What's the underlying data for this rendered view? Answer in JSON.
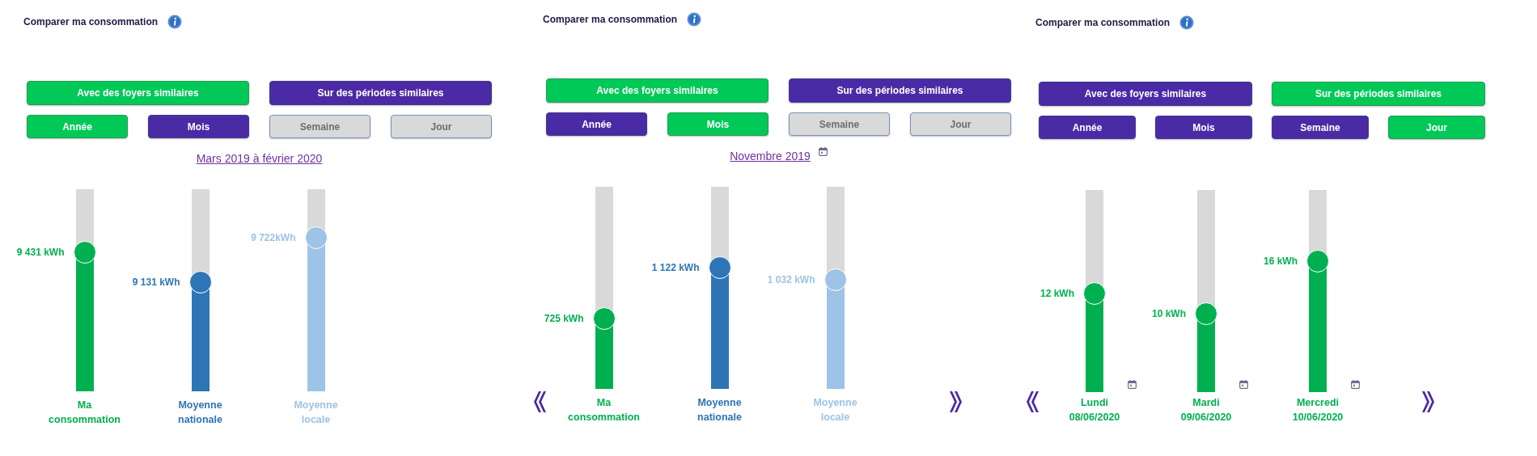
{
  "panels": [
    {
      "title": "Comparer ma consommation",
      "navigation": false,
      "buttons_top": [
        {
          "label": "Avec des foyers similaires",
          "selected": true,
          "disabled": false
        },
        {
          "label": "Sur des périodes similaires",
          "selected": false,
          "disabled": false
        }
      ],
      "buttons_period": [
        {
          "label": "Année",
          "selected": true,
          "disabled": false
        },
        {
          "label": "Mois",
          "selected": false,
          "disabled": false
        },
        {
          "label": "Semaine",
          "selected": false,
          "disabled": true
        },
        {
          "label": "Jour",
          "selected": false,
          "disabled": true
        }
      ],
      "date_link": {
        "text": "Mars 2019 à février 2020",
        "calendar": false
      },
      "bars": [
        {
          "label_lines": [
            "Ma",
            "consommation"
          ],
          "reading": "9 431 kWh",
          "level": 0.69,
          "color": "#00b050",
          "calendar": false
        },
        {
          "label_lines": [
            "Moyenne",
            "nationale"
          ],
          "reading": "9 131 kWh",
          "level": 0.54,
          "color": "#2e75b6",
          "calendar": false
        },
        {
          "label_lines": [
            "Moyenne",
            "locale"
          ],
          "reading": "9 722kWh",
          "level": 0.76,
          "color": "#9dc3e6",
          "calendar": false
        }
      ]
    },
    {
      "title": "Comparer ma consommation",
      "navigation": true,
      "buttons_top": [
        {
          "label": "Avec des foyers similaires",
          "selected": true,
          "disabled": false
        },
        {
          "label": "Sur des périodes similaires",
          "selected": false,
          "disabled": false
        }
      ],
      "buttons_period": [
        {
          "label": "Année",
          "selected": false,
          "disabled": false
        },
        {
          "label": "Mois",
          "selected": true,
          "disabled": false
        },
        {
          "label": "Semaine",
          "selected": false,
          "disabled": true
        },
        {
          "label": "Jour",
          "selected": false,
          "disabled": true
        }
      ],
      "date_link": {
        "text": "Novembre 2019",
        "calendar": true
      },
      "bars": [
        {
          "label_lines": [
            "Ma",
            "consommation"
          ],
          "reading": "725 kWh",
          "level": 0.35,
          "color": "#00b050",
          "calendar": false
        },
        {
          "label_lines": [
            "Moyenne",
            "nationale"
          ],
          "reading": "1 122 kWh",
          "level": 0.6,
          "color": "#2e75b6",
          "calendar": false
        },
        {
          "label_lines": [
            "Moyenne",
            "locale"
          ],
          "reading": "1 032 kWh",
          "level": 0.54,
          "color": "#9dc3e6",
          "calendar": false
        }
      ]
    },
    {
      "title": "Comparer ma consommation",
      "navigation": true,
      "buttons_top": [
        {
          "label": "Avec des foyers similaires",
          "selected": false,
          "disabled": false
        },
        {
          "label": "Sur des périodes similaires",
          "selected": true,
          "disabled": false
        }
      ],
      "buttons_period": [
        {
          "label": "Année",
          "selected": false,
          "disabled": false
        },
        {
          "label": "Mois",
          "selected": false,
          "disabled": false
        },
        {
          "label": "Semaine",
          "selected": false,
          "disabled": false
        },
        {
          "label": "Jour",
          "selected": true,
          "disabled": false
        }
      ],
      "bars": [
        {
          "label_lines": [
            "Lundi",
            "08/06/2020"
          ],
          "reading": "12 kWh",
          "level": 0.49,
          "color": "#00b050",
          "calendar": true
        },
        {
          "label_lines": [
            "Mardi",
            "09/06/2020"
          ],
          "reading": "10 kWh",
          "level": 0.39,
          "color": "#00b050",
          "calendar": true
        },
        {
          "label_lines": [
            "Mercredi",
            "10/06/2020"
          ],
          "reading": "16 kWh",
          "level": 0.65,
          "color": "#00b050",
          "calendar": true
        }
      ]
    }
  ]
}
